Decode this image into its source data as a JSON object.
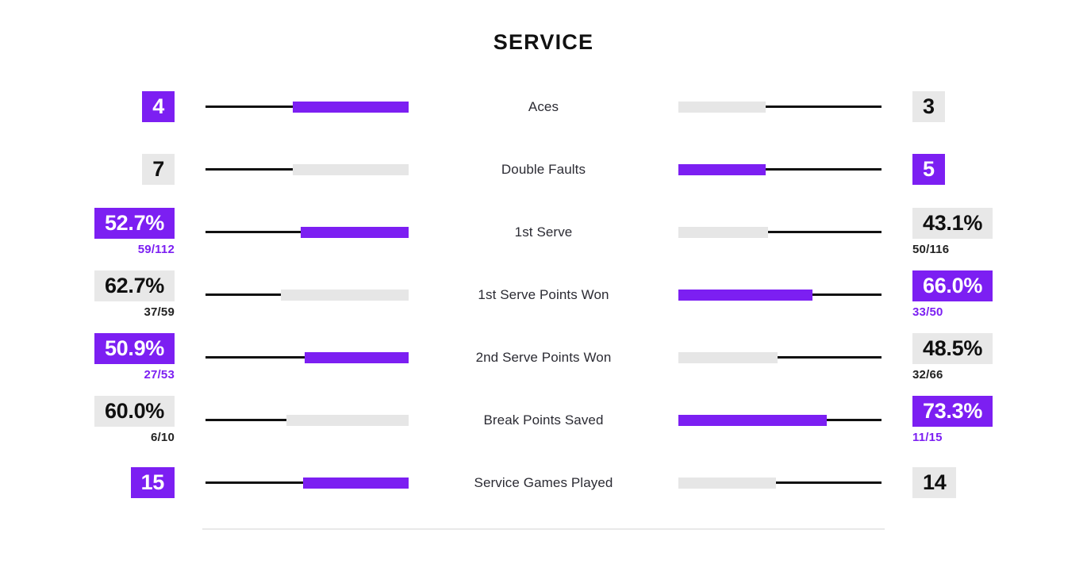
{
  "header": {
    "title": "SERVICE"
  },
  "colors": {
    "accent": "#7c1ff2",
    "neutral_bar": "#e6e6e6",
    "neutral_badge": "#e8e8e8",
    "rule": "#111111",
    "divider": "#e9e9e9"
  },
  "chart_data": {
    "type": "bar",
    "title": "SERVICE",
    "subtitle": "",
    "xlabel": "",
    "ylabel": "",
    "legend": [],
    "orientation": "horizontal-diverging",
    "categories": [
      "Aces",
      "Double Faults",
      "1st Serve",
      "1st Serve Points Won",
      "2nd Serve Points Won",
      "Break Points Saved",
      "Service Games Played"
    ],
    "series": [
      {
        "name": "left",
        "values": [
          4,
          7,
          52.7,
          62.7,
          50.9,
          60.0,
          15
        ]
      },
      {
        "name": "right",
        "values": [
          3,
          5,
          43.1,
          66.0,
          48.5,
          73.3,
          14
        ]
      }
    ]
  },
  "rows": [
    {
      "label": "Aces",
      "left": {
        "value": "4",
        "sub": "",
        "winner": true,
        "fill_pct": 57
      },
      "right": {
        "value": "3",
        "sub": "",
        "winner": false,
        "fill_pct": 43
      }
    },
    {
      "label": "Double Faults",
      "left": {
        "value": "7",
        "sub": "",
        "winner": false,
        "fill_pct": 57
      },
      "right": {
        "value": "5",
        "sub": "",
        "winner": true,
        "fill_pct": 43
      }
    },
    {
      "label": "1st Serve",
      "left": {
        "value": "52.7%",
        "sub": "59/112",
        "winner": true,
        "fill_pct": 53
      },
      "right": {
        "value": "43.1%",
        "sub": "50/116",
        "winner": false,
        "fill_pct": 44
      }
    },
    {
      "label": "1st Serve Points Won",
      "left": {
        "value": "62.7%",
        "sub": "37/59",
        "winner": false,
        "fill_pct": 63
      },
      "right": {
        "value": "66.0%",
        "sub": "33/50",
        "winner": true,
        "fill_pct": 66
      }
    },
    {
      "label": "2nd Serve Points Won",
      "left": {
        "value": "50.9%",
        "sub": "27/53",
        "winner": true,
        "fill_pct": 51
      },
      "right": {
        "value": "48.5%",
        "sub": "32/66",
        "winner": false,
        "fill_pct": 49
      }
    },
    {
      "label": "Break Points Saved",
      "left": {
        "value": "60.0%",
        "sub": "6/10",
        "winner": false,
        "fill_pct": 60
      },
      "right": {
        "value": "73.3%",
        "sub": "11/15",
        "winner": true,
        "fill_pct": 73
      }
    },
    {
      "label": "Service Games Played",
      "left": {
        "value": "15",
        "sub": "",
        "winner": true,
        "fill_pct": 52
      },
      "right": {
        "value": "14",
        "sub": "",
        "winner": false,
        "fill_pct": 48
      }
    }
  ]
}
